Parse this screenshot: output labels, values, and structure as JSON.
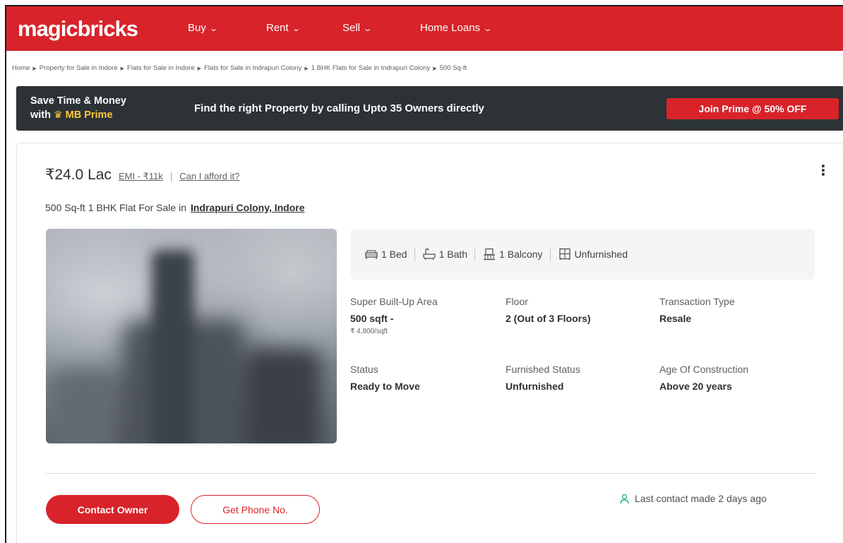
{
  "header": {
    "logo": "magicbricks",
    "nav": [
      {
        "label": "Buy"
      },
      {
        "label": "Rent"
      },
      {
        "label": "Sell"
      },
      {
        "label": "Home Loans"
      }
    ],
    "brand_color": "#d8232a"
  },
  "breadcrumb": [
    "Home",
    "Property for Sale in Indore",
    "Flats for Sale in Indore",
    "Flats for Sale in Indrapuri Colony",
    "1 BHK Flats for Sale in Indrapuri Colony",
    "500 Sq-ft"
  ],
  "prime_banner": {
    "line1": "Save Time & Money",
    "line2_prefix": "with",
    "line2_brand": "MB Prime",
    "message": "Find the right Property by calling Upto 35 Owners directly",
    "cta": "Join Prime @ 50% OFF",
    "icon": "crown-icon"
  },
  "listing": {
    "price": "₹24.0 Lac",
    "emi": "EMI - ₹11k",
    "separator": "|",
    "afford": "Can I afford it?",
    "more_icon": "⋮",
    "title": "500 Sq-ft 1 BHK Flat For Sale in",
    "location": "Indrapuri Colony, Indore",
    "amenities": [
      {
        "icon": "bed-icon",
        "label": "1 Bed"
      },
      {
        "icon": "bath-icon",
        "label": "1 Bath"
      },
      {
        "icon": "balcony-icon",
        "label": "1 Balcony"
      },
      {
        "icon": "furnish-icon",
        "label": "Unfurnished"
      }
    ],
    "attributes": {
      "area": {
        "label": "Super Built-Up Area",
        "value": "500 sqft -",
        "sub": "₹ 4,800/sqft"
      },
      "floor": {
        "label": "Floor",
        "value": "2 (Out of 3 Floors)"
      },
      "transaction": {
        "label": "Transaction Type",
        "value": "Resale"
      },
      "status": {
        "label": "Status",
        "value": "Ready to Move"
      },
      "furnished": {
        "label": "Furnished Status",
        "value": "Unfurnished"
      },
      "age": {
        "label": "Age Of Construction",
        "value": "Above 20 years"
      }
    },
    "contact_owner": "Contact Owner",
    "get_phone": "Get Phone No.",
    "last_contact": "Last contact made 2 days ago"
  }
}
